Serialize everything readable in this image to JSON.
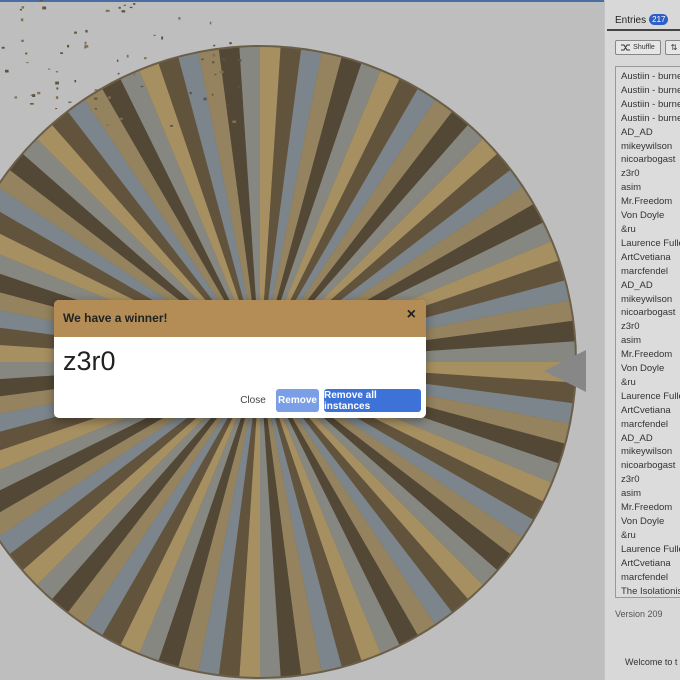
{
  "dialog": {
    "title": "We have a winner!",
    "close_x": "×",
    "winner": "z3r0",
    "close_label": "Close",
    "remove_label": "Remove",
    "remove_all_label": "Remove all instances"
  },
  "panel": {
    "tab_label": "Entries",
    "count": "217",
    "shuffle_label": "Shuffle",
    "sort_icon": "⇅",
    "entries": [
      "Austiin - burne",
      "Austiin - burne",
      "Austiin - burne",
      "Austiin - burne",
      "AD_AD",
      "mikeywilson",
      "nicoarbogast",
      "z3r0",
      "asim",
      "Mr.Freedom",
      "Von Doyle",
      "&ru",
      "Laurence Fuller",
      "ArtCvetiana",
      "marcfendel",
      "AD_AD",
      "mikeywilson",
      "nicoarbogast",
      "z3r0",
      "asim",
      "Mr.Freedom",
      "Von Doyle",
      "&ru",
      "Laurence Fuller",
      "ArtCvetiana",
      "marcfendel",
      "AD_AD",
      "mikeywilson",
      "nicoarbogast",
      "z3r0",
      "asim",
      "Mr.Freedom",
      "Von Doyle",
      "&ru",
      "Laurence Fuller",
      "ArtCvetiana",
      "marcfendel",
      "The Isolationist"
    ],
    "version": "Version 209",
    "welcome": "Welcome to t"
  },
  "colors": {
    "header": "#b38d55",
    "primary_button": "#3d73d9",
    "secondary_button": "#7a9fe6",
    "badge": "#2f5fc4",
    "wheel_segments": [
      "#b89a5c",
      "#5e4a2c",
      "#7f8c94",
      "#a08a58",
      "#4a3a22",
      "#8e8f86"
    ]
  },
  "icons": {
    "pointer": "triangle-pointer-icon",
    "shuffle": "shuffle-icon",
    "sort": "sort-icon",
    "close": "close-icon"
  }
}
